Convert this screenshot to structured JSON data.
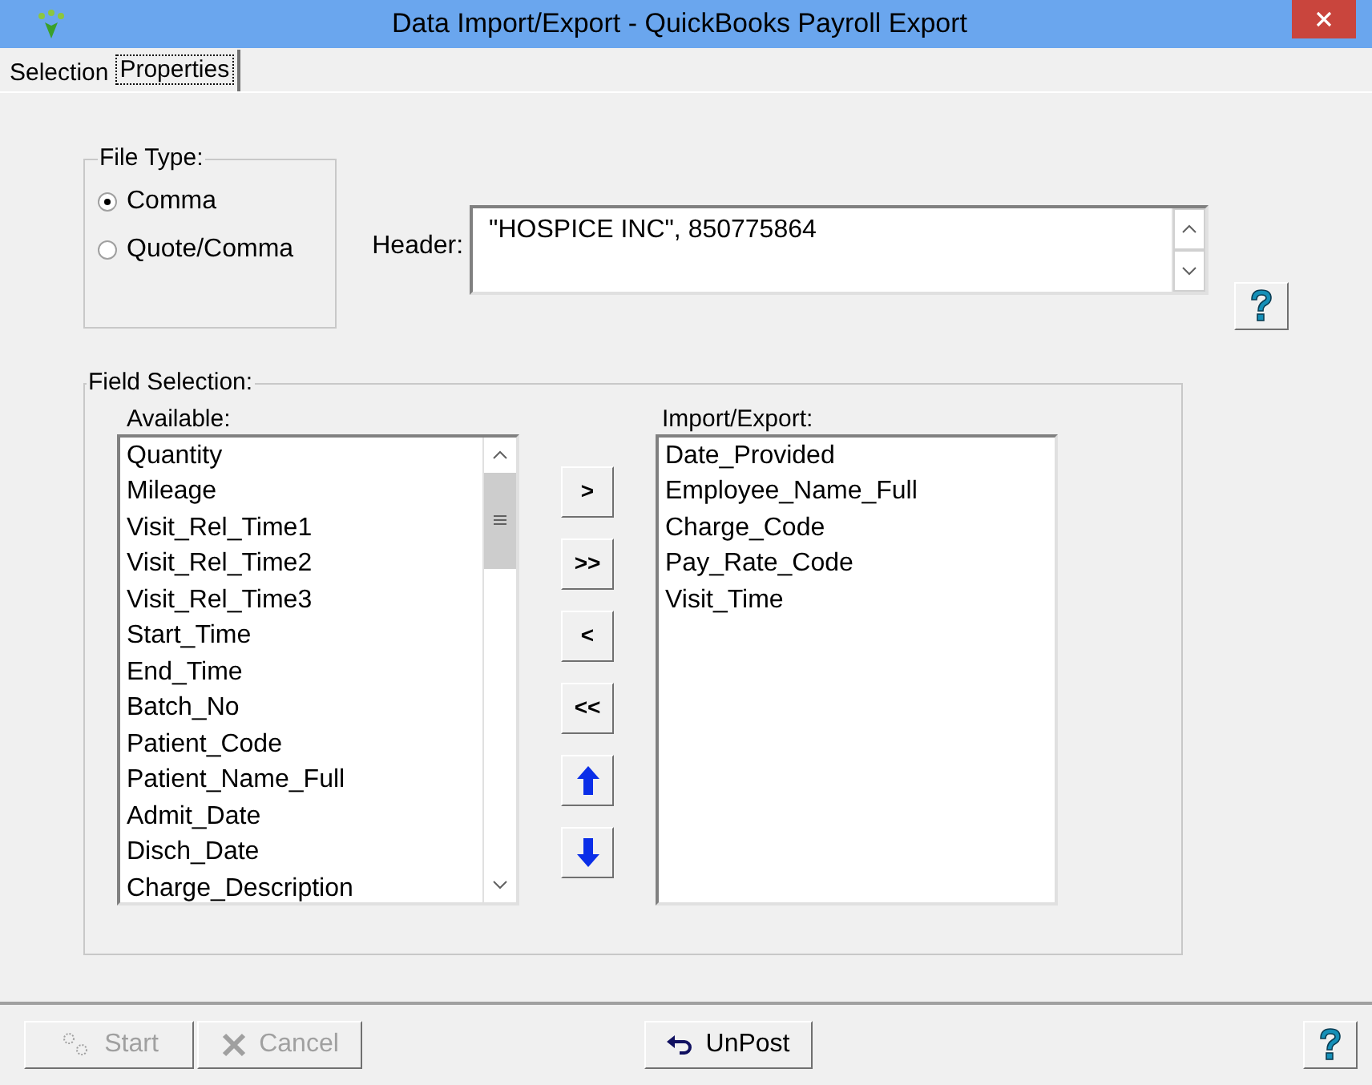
{
  "window": {
    "title": "Data Import/Export - QuickBooks Payroll Export"
  },
  "tabs": [
    {
      "label": "Selection",
      "selected": false
    },
    {
      "label": "Properties",
      "selected": true
    }
  ],
  "file_type": {
    "label": "File Type:",
    "options": [
      {
        "label": "Comma",
        "selected": true
      },
      {
        "label": "Quote/Comma",
        "selected": false
      }
    ]
  },
  "header": {
    "label": "Header:",
    "value": "\"HOSPICE INC\", 850775864"
  },
  "field_selection": {
    "label": "Field Selection:",
    "available": {
      "label": "Available:",
      "items": [
        "Quantity",
        "Mileage",
        "Visit_Rel_Time1",
        "Visit_Rel_Time2",
        "Visit_Rel_Time3",
        "Start_Time",
        "End_Time",
        "Batch_No",
        "Patient_Code",
        "Patient_Name_Full",
        "Admit_Date",
        "Disch_Date",
        "Charge_Description"
      ]
    },
    "move_buttons": [
      {
        "kind": "text",
        "label": ">"
      },
      {
        "kind": "text",
        "label": ">>"
      },
      {
        "kind": "text",
        "label": "<"
      },
      {
        "kind": "text",
        "label": "<<"
      },
      {
        "kind": "up"
      },
      {
        "kind": "down"
      }
    ],
    "import_export": {
      "label": "Import/Export:",
      "items": [
        "Date_Provided",
        "Employee_Name_Full",
        "Charge_Code",
        "Pay_Rate_Code",
        "Visit_Time"
      ]
    }
  },
  "buttons": [
    {
      "kind": "start",
      "label": "Start",
      "disabled": true
    },
    {
      "kind": "cancel",
      "label": "Cancel",
      "disabled": true
    },
    {
      "kind": "unpost",
      "label": "UnPost",
      "disabled": false
    }
  ]
}
